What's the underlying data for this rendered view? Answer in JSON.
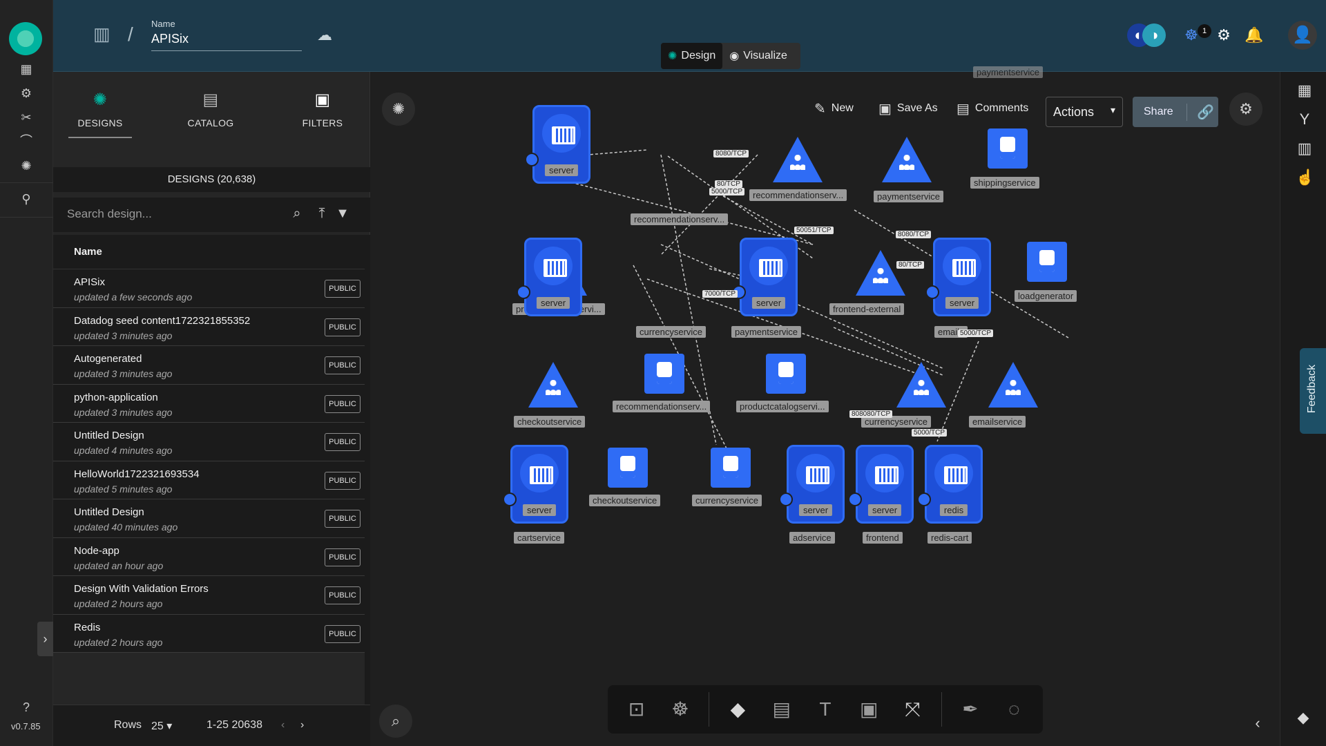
{
  "header": {
    "name_label": "Name",
    "name_value": "APISix",
    "modes": [
      {
        "label": "Design",
        "active": true
      },
      {
        "label": "Visualize",
        "active": false
      }
    ],
    "notification_count": "1"
  },
  "sidebar": {
    "version": "v0.7.85"
  },
  "panel": {
    "tabs": [
      "DESIGNS",
      "CATALOG",
      "FILTERS"
    ],
    "designs_count": "DESIGNS (20,638)",
    "search_placeholder": "Search design...",
    "column_header": "Name",
    "designs": [
      {
        "name": "APISix",
        "updated": "updated a few seconds ago",
        "visibility": "PUBLIC"
      },
      {
        "name": "Datadog seed content1722321855352",
        "updated": "updated 3 minutes ago",
        "visibility": "PUBLIC"
      },
      {
        "name": "Autogenerated",
        "updated": "updated 3 minutes ago",
        "visibility": "PUBLIC"
      },
      {
        "name": "python-application",
        "updated": "updated 3 minutes ago",
        "visibility": "PUBLIC"
      },
      {
        "name": "Untitled Design",
        "updated": "updated 4 minutes ago",
        "visibility": "PUBLIC"
      },
      {
        "name": "HelloWorld1722321693534",
        "updated": "updated 5 minutes ago",
        "visibility": "PUBLIC"
      },
      {
        "name": "Untitled Design",
        "updated": "updated 40 minutes ago",
        "visibility": "PUBLIC"
      },
      {
        "name": "Node-app",
        "updated": "updated an hour ago",
        "visibility": "PUBLIC"
      },
      {
        "name": "Design With Validation Errors",
        "updated": "updated 2 hours ago",
        "visibility": "PUBLIC"
      },
      {
        "name": "Redis",
        "updated": "updated 2 hours ago",
        "visibility": "PUBLIC"
      }
    ],
    "pager": {
      "rows_label": "Rows",
      "rows_value": "25",
      "range": "1-25 20638"
    }
  },
  "toolbar": {
    "new_label": "New",
    "save_as_label": "Save As",
    "comments_label": "Comments",
    "actions_label": "Actions",
    "share_label": "Share"
  },
  "graph": {
    "boxes": [
      {
        "inner": "server",
        "name": "recommendationserv..."
      },
      {
        "inner": "server",
        "name": "currencyservice"
      },
      {
        "inner": "server",
        "name": "paymentservice"
      },
      {
        "inner": "server",
        "name": "emails"
      },
      {
        "inner": "server",
        "name": "cartservice"
      },
      {
        "inner": "server",
        "name": "adservice"
      },
      {
        "inner": "server",
        "name": "frontend"
      },
      {
        "inner": "redis",
        "name": "redis-cart"
      }
    ],
    "services": [
      "recommendationserv...",
      "paymentservice",
      "productcatalogservi...",
      "frontend-external",
      "checkoutservice",
      "currencyservice",
      "emailservice"
    ],
    "accounts": [
      "shippingservice",
      "loadgenerator",
      "recommendationserv...",
      "productcatalogservi...",
      "checkoutservice",
      "currencyservice"
    ],
    "edge_labels": [
      "8080/TCP",
      "80/TCP",
      "5000/TCP",
      "50051/TCP",
      "8080/TCP",
      "80/TCP",
      "7000/TCP",
      "5000/TCP",
      "808080/TCP",
      "5000/TCP"
    ],
    "cut_label": "paymentservice"
  },
  "feedback_label": "Feedback"
}
